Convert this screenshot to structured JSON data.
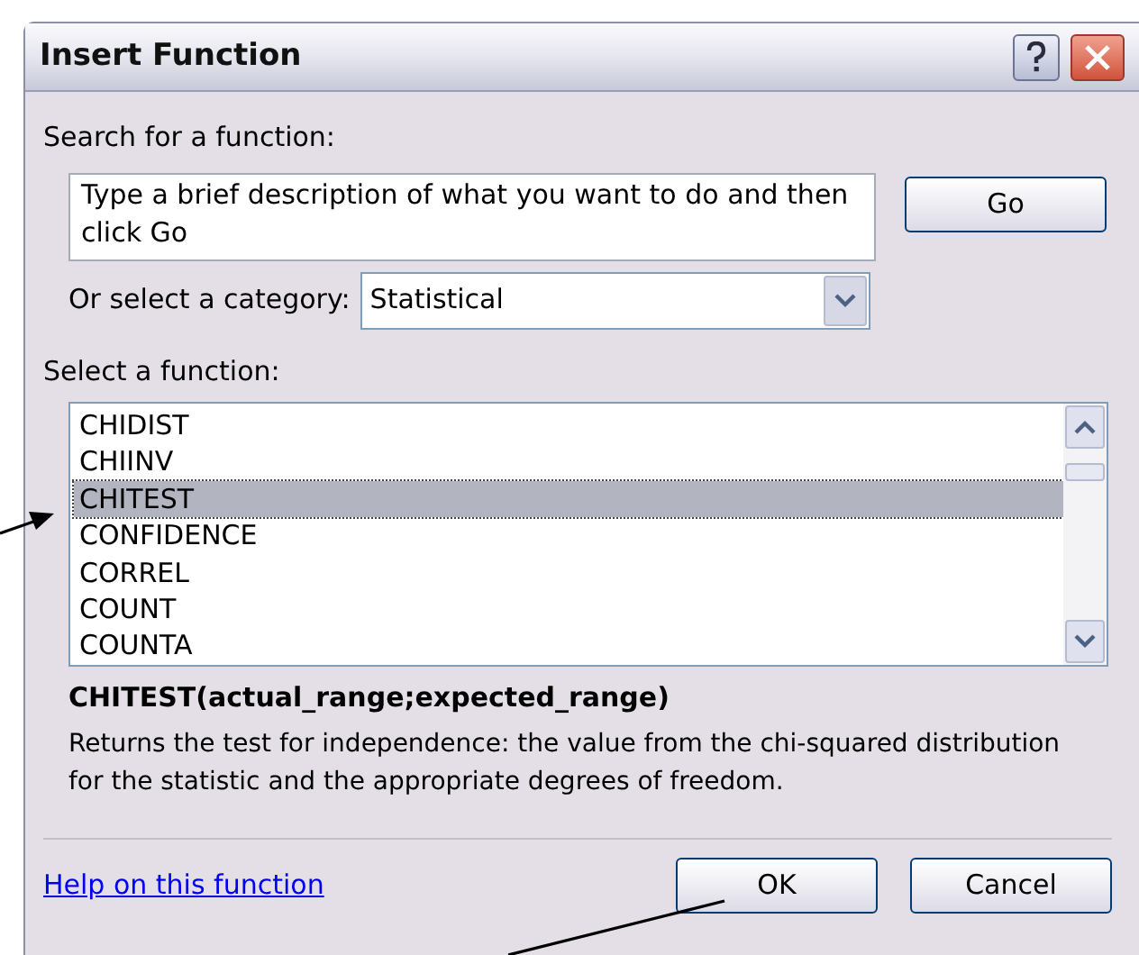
{
  "window": {
    "title": "Insert Function"
  },
  "search": {
    "label": "Search for a function:",
    "value": "Type a brief description of what you want to do and then click Go",
    "button": "Go"
  },
  "category": {
    "label": "Or select a category:",
    "value": "Statistical"
  },
  "functions": {
    "label": "Select a function:",
    "items": [
      {
        "label": "CHIDIST",
        "selected": false
      },
      {
        "label": "CHIINV",
        "selected": false
      },
      {
        "label": "CHITEST",
        "selected": true
      },
      {
        "label": "CONFIDENCE",
        "selected": false
      },
      {
        "label": "CORREL",
        "selected": false
      },
      {
        "label": "COUNT",
        "selected": false
      },
      {
        "label": "COUNTA",
        "selected": false
      }
    ]
  },
  "signature": "CHITEST(actual_range;expected_range)",
  "description": "Returns the test for independence: the value from the chi-squared distribution for the statistic and the appropriate degrees of freedom.",
  "help_link": "Help on this function",
  "buttons": [
    "OK",
    "Cancel"
  ]
}
